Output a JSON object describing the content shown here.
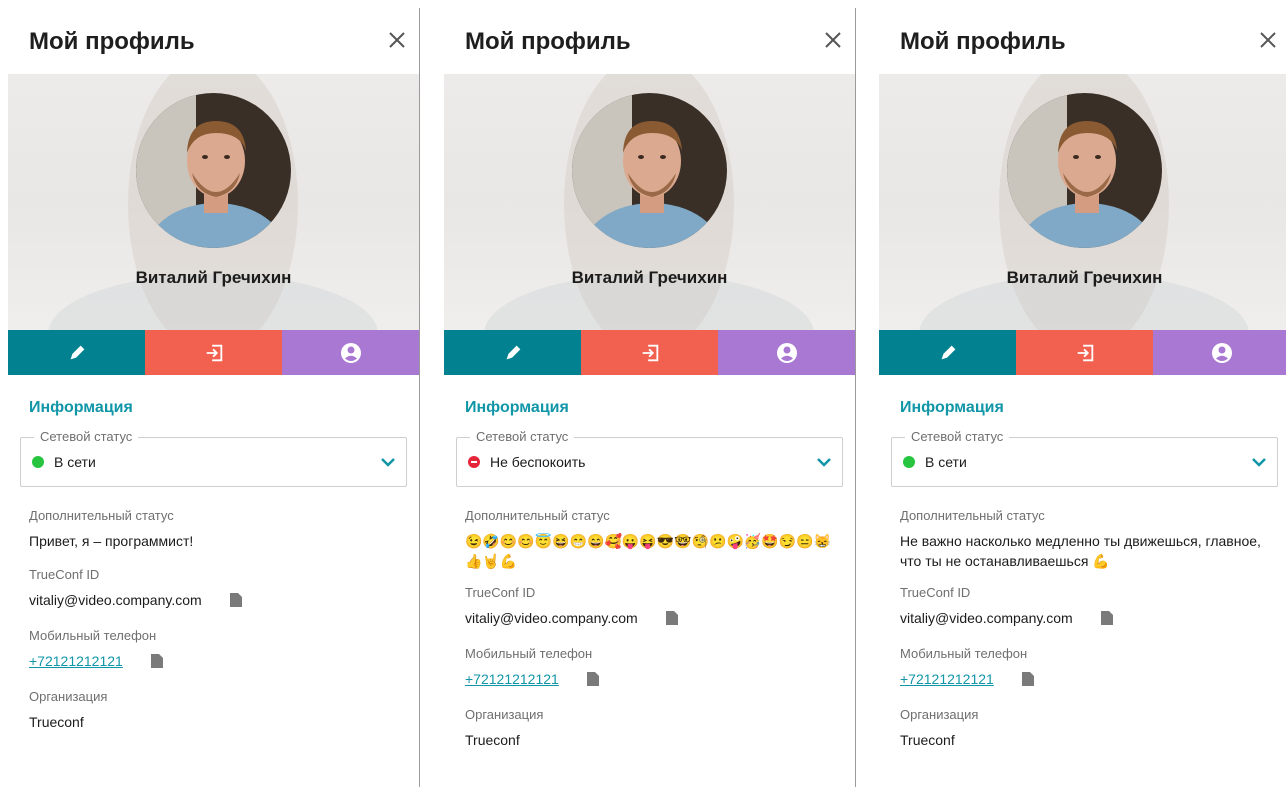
{
  "panels": [
    {
      "title": "Мой профиль",
      "name": "Виталий Гречихин",
      "section_label": "Информация",
      "network_status_label": "Сетевой статус",
      "network_status": "В сети",
      "network_status_color": "#27c53f",
      "extra_status_label": "Дополнительный статус",
      "extra_status": "Привет, я – программист!",
      "trueconf_id_label": "TrueConf ID",
      "trueconf_id": "vitaliy@video.company.com",
      "phone_label": "Мобильный телефон",
      "phone": "+72121212121",
      "org_label": "Организация",
      "org": "Trueconf"
    },
    {
      "title": "Мой профиль",
      "name": "Виталий Гречихин",
      "section_label": "Информация",
      "network_status_label": "Сетевой статус",
      "network_status": "Не беспокоить",
      "network_status_color": "#e5263a",
      "extra_status_label": "Дополнительный статус",
      "extra_status": "😉🤣😊😊😇😆😁😄🥰😛😝😎🤓🧐😕🤪🥳🤩😏😑😸👍🤘💪",
      "trueconf_id_label": "TrueConf ID",
      "trueconf_id": "vitaliy@video.company.com",
      "phone_label": "Мобильный телефон",
      "phone": "+72121212121",
      "org_label": "Организация",
      "org": "Trueconf"
    },
    {
      "title": "Мой профиль",
      "name": "Виталий Гречихин",
      "section_label": "Информация",
      "network_status_label": "Сетевой статус",
      "network_status": "В сети",
      "network_status_color": "#27c53f",
      "extra_status_label": "Дополнительный статус",
      "extra_status": "Не важно насколько медленно ты движешься, главное, что ты не останавливаешься 💪",
      "trueconf_id_label": "TrueConf ID",
      "trueconf_id": "vitaliy@video.company.com",
      "phone_label": "Мобильный телефон",
      "phone": "+72121212121",
      "org_label": "Организация",
      "org": "Trueconf"
    }
  ],
  "icons": {
    "close": "close-icon",
    "edit": "pencil-icon",
    "logout": "logout-icon",
    "account": "account-circle-icon",
    "dropdown": "chevron-down-icon",
    "copy": "copy-icon"
  },
  "colors": {
    "edit": "#028291",
    "logout": "#f2604f",
    "account": "#a978d2",
    "accent": "#1196a8"
  }
}
